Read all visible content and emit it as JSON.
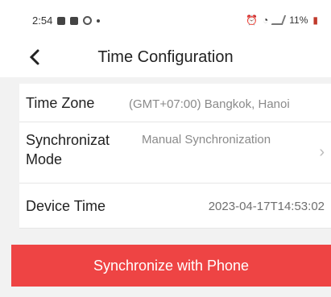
{
  "status_bar": {
    "time": "2:54",
    "battery": "11%",
    "icons": [
      "message-icon",
      "lock-icon",
      "instagram-icon",
      "dot-icon",
      "alarm-icon",
      "wifi-icon",
      "signal-icon",
      "battery-icon"
    ]
  },
  "header": {
    "title": "Time Configuration",
    "back_icon": "chevron-left-icon"
  },
  "settings": [
    {
      "label": "Time Zone",
      "value": "(GMT+07:00) Bangkok, Hanoi"
    },
    {
      "label": "Synchronizat Mode",
      "value": "Manual Synchronization",
      "chevron": "chevron-right-icon"
    },
    {
      "label": "Device Time",
      "value": "2023-04-17T14:53:02"
    }
  ],
  "button": {
    "label": "Synchronize with Phone",
    "color": "#ee4444"
  }
}
